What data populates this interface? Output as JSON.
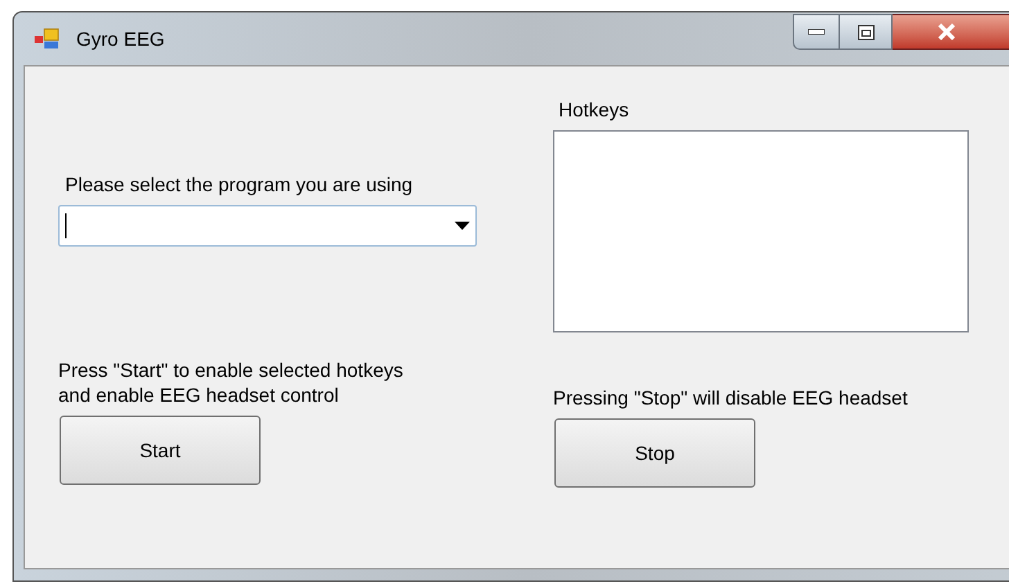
{
  "window": {
    "title": "Gyro EEG"
  },
  "program_select": {
    "label": "Please select the program you are using"
  },
  "hotkeys": {
    "label": "Hotkeys"
  },
  "start": {
    "description": "Press \"Start\" to enable selected hotkeys\nand enable EEG headset control",
    "button": "Start"
  },
  "stop": {
    "description": "Pressing \"Stop\" will disable EEG headset",
    "button": "Stop"
  }
}
